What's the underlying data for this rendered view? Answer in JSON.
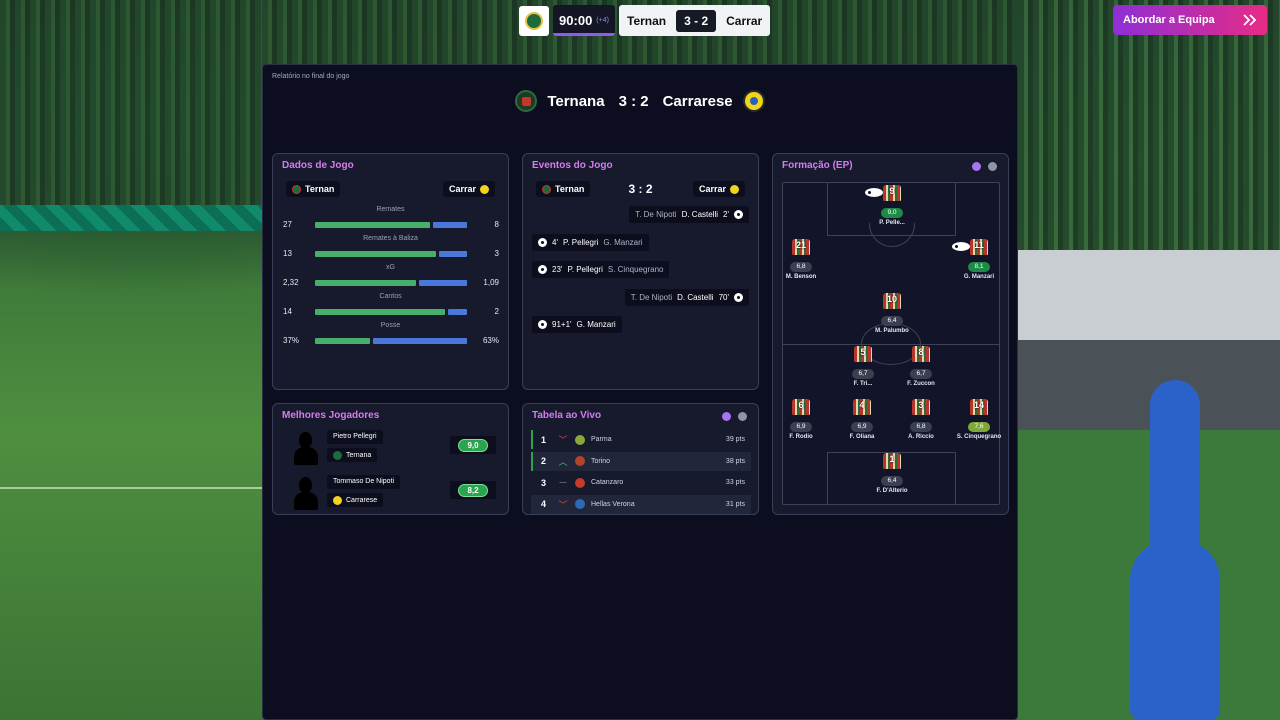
{
  "hud": {
    "time": "90:00",
    "added": "(+4)",
    "home_short": "Ternan",
    "score": "3 - 2",
    "away_short": "Carrar"
  },
  "approach_button": {
    "label": "Abordar a Equipa",
    "icon": "double-chevron-right-icon"
  },
  "report": {
    "label": "Relatório no final do jogo",
    "home": "Ternana",
    "away": "Carrarese",
    "result": "3 : 2"
  },
  "colors": {
    "accent_title": "#d77cf0",
    "home_bar": "#46b06a",
    "away_bar": "#4a78d8",
    "rating_good": "#1f8a47",
    "purple_dot": "#a874f0"
  },
  "match_data": {
    "title": "Dados de Jogo",
    "home": "Ternan",
    "away": "Carrar",
    "stats": [
      {
        "label": "Remates",
        "home": "27",
        "away": "8",
        "home_ratio": 0.77
      },
      {
        "label": "Remates à Baliza",
        "home": "13",
        "away": "3",
        "home_ratio": 0.81
      },
      {
        "label": "xG",
        "home": "2,32",
        "away": "1,09",
        "home_ratio": 0.68
      },
      {
        "label": "Cantos",
        "home": "14",
        "away": "2",
        "home_ratio": 0.87
      },
      {
        "label": "Posse",
        "home": "37%",
        "away": "63%",
        "home_ratio": 0.37
      }
    ]
  },
  "events": {
    "title": "Eventos do Jogo",
    "home": "Ternan",
    "away": "Carrar",
    "score": "3 : 2",
    "list": [
      {
        "side": "away",
        "assist": "T. De Nipoti",
        "scorer": "D. Castelli",
        "minute": "2'"
      },
      {
        "side": "home",
        "minute": "4'",
        "scorer": "P. Pellegri",
        "assist": "G. Manzari"
      },
      {
        "side": "home",
        "minute": "23'",
        "scorer": "P. Pellegri",
        "assist": "S. Cinquegrano"
      },
      {
        "side": "away",
        "assist": "T. De Nipoti",
        "scorer": "D. Castelli",
        "minute": "70'"
      },
      {
        "side": "home",
        "minute": "91+1'",
        "scorer": "G. Manzari",
        "assist": ""
      }
    ]
  },
  "formation": {
    "title": "Formação (EP)",
    "players": [
      {
        "number": "9",
        "rating": "9,0",
        "name": "P. Pelle...",
        "goal": true,
        "tier": "good"
      },
      {
        "number": "21",
        "rating": "6,8",
        "name": "M. Benson",
        "goal": false,
        "tier": ""
      },
      {
        "number": "11",
        "rating": "8,1",
        "name": "G. Manzari",
        "goal": true,
        "tier": "good"
      },
      {
        "number": "10",
        "rating": "6,4",
        "name": "M. Palumbo",
        "goal": false,
        "tier": ""
      },
      {
        "number": "5",
        "rating": "6,7",
        "name": "F. Tri...",
        "goal": false,
        "tier": ""
      },
      {
        "number": "8",
        "rating": "6,7",
        "name": "F. Zuccon",
        "goal": false,
        "tier": ""
      },
      {
        "number": "6",
        "rating": "6,9",
        "name": "F. Rodio",
        "goal": false,
        "tier": ""
      },
      {
        "number": "4",
        "rating": "6,9",
        "name": "F. Oliana",
        "goal": false,
        "tier": ""
      },
      {
        "number": "3",
        "rating": "6,8",
        "name": "A. Riccio",
        "goal": false,
        "tier": ""
      },
      {
        "number": "14",
        "rating": "7,6",
        "name": "S. Cinquegrano",
        "goal": false,
        "tier": "great"
      },
      {
        "number": "1",
        "rating": "6,4",
        "name": "F. D'Alterio",
        "goal": false,
        "tier": ""
      }
    ]
  },
  "best_players": {
    "title": "Melhores Jogadores",
    "list": [
      {
        "name": "Pietro Pellegri",
        "team": "Ternana",
        "rating": "9,0"
      },
      {
        "name": "Tommaso De Nipoti",
        "team": "Carrarese",
        "rating": "8,2"
      }
    ]
  },
  "live_table": {
    "title": "Tabela ao Vivo",
    "rows": [
      {
        "pos": "1",
        "trend": "down",
        "club": "Parma",
        "pts": "39 pts"
      },
      {
        "pos": "2",
        "trend": "up",
        "club": "Torino",
        "pts": "38 pts"
      },
      {
        "pos": "3",
        "trend": "same",
        "club": "Catanzaro",
        "pts": "33 pts"
      },
      {
        "pos": "4",
        "trend": "down",
        "club": "Hellas Verona",
        "pts": "31 pts"
      }
    ]
  }
}
